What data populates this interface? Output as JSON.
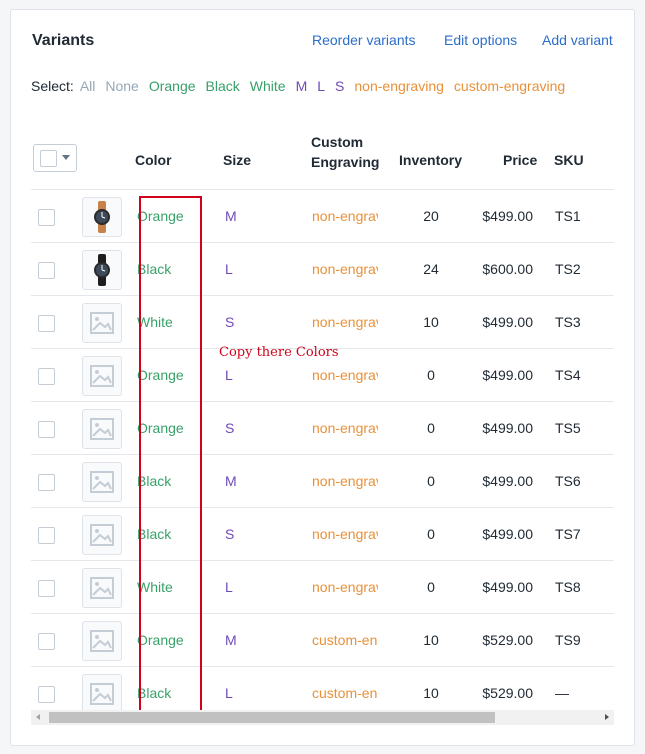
{
  "card": {
    "title": "Variants",
    "actions": {
      "reorder": "Reorder variants",
      "edit": "Edit options",
      "add": "Add variant"
    }
  },
  "select": {
    "label": "Select:",
    "options": [
      "All",
      "None",
      "Orange",
      "Black",
      "White",
      "M",
      "L",
      "S",
      "non-engraving",
      "custom-engraving"
    ]
  },
  "table": {
    "headers": {
      "color": "Color",
      "size": "Size",
      "engraving_1": "Custom",
      "engraving_2": "Engraving",
      "inventory": "Inventory",
      "price": "Price",
      "sku": "SKU"
    },
    "rows": [
      {
        "thumb": "watch-orange-image",
        "color": "Orange",
        "size": "M",
        "engraving": "non-engraving",
        "inventory": "20",
        "price": "$499.00",
        "sku": "TS1"
      },
      {
        "thumb": "watch-black-image",
        "color": "Black",
        "size": "L",
        "engraving": "non-engraving",
        "inventory": "24",
        "price": "$600.00",
        "sku": "TS2"
      },
      {
        "thumb": "image-placeholder-icon",
        "color": "White",
        "size": "S",
        "engraving": "non-engraving",
        "inventory": "10",
        "price": "$499.00",
        "sku": "TS3"
      },
      {
        "thumb": "image-placeholder-icon",
        "color": "Orange",
        "size": "L",
        "engraving": "non-engraving",
        "inventory": "0",
        "price": "$499.00",
        "sku": "TS4"
      },
      {
        "thumb": "image-placeholder-icon",
        "color": "Orange",
        "size": "S",
        "engraving": "non-engraving",
        "inventory": "0",
        "price": "$499.00",
        "sku": "TS5"
      },
      {
        "thumb": "image-placeholder-icon",
        "color": "Black",
        "size": "M",
        "engraving": "non-engraving",
        "inventory": "0",
        "price": "$499.00",
        "sku": "TS6"
      },
      {
        "thumb": "image-placeholder-icon",
        "color": "Black",
        "size": "S",
        "engraving": "non-engraving",
        "inventory": "0",
        "price": "$499.00",
        "sku": "TS7"
      },
      {
        "thumb": "image-placeholder-icon",
        "color": "White",
        "size": "L",
        "engraving": "non-engraving",
        "inventory": "0",
        "price": "$499.00",
        "sku": "TS8"
      },
      {
        "thumb": "image-placeholder-icon",
        "color": "Orange",
        "size": "M",
        "engraving": "custom-engraving",
        "inventory": "10",
        "price": "$529.00",
        "sku": "TS9"
      },
      {
        "thumb": "image-placeholder-icon",
        "color": "Black",
        "size": "L",
        "engraving": "custom-engraving",
        "inventory": "10",
        "price": "$529.00",
        "sku": "—"
      }
    ]
  },
  "annotation": {
    "text": "Copy there Colors"
  },
  "colors": {
    "link": "#2c6ecb",
    "color_value": "#38a169",
    "size_value": "#6f4ab7",
    "engraving_value": "#e8913a",
    "annotation": "#d0021b"
  }
}
